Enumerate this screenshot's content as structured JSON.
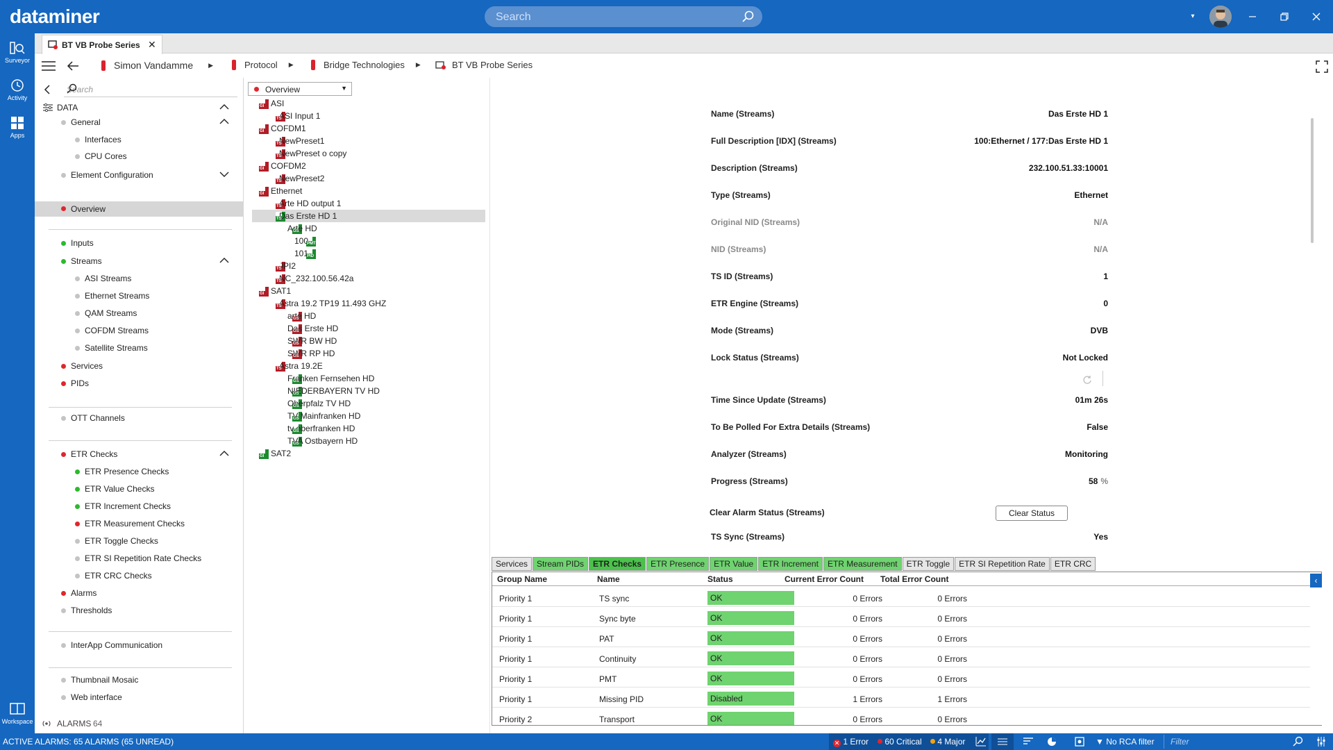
{
  "app": {
    "logo": "dataminer",
    "search_placeholder": "Search"
  },
  "rail": [
    {
      "label": "Surveyor",
      "icon": "surveyor-icon"
    },
    {
      "label": "Activity",
      "icon": "activity-icon"
    },
    {
      "label": "Apps",
      "icon": "apps-icon"
    },
    {
      "label": "Workspace",
      "icon": "workspace-icon"
    }
  ],
  "card_tab": {
    "title": "BT VB Probe Series",
    "close": "✕"
  },
  "breadcrumb": [
    "Simon Vandamme",
    "Protocol",
    "Bridge Technologies",
    "BT VB Probe Series"
  ],
  "nav": {
    "search_placeholder": "Search",
    "data_label": "DATA",
    "items": [
      {
        "label": "General",
        "dot": "gy",
        "indent": 0
      },
      {
        "label": "Interfaces",
        "dot": "gy",
        "indent": 1
      },
      {
        "label": "CPU Cores",
        "dot": "gy",
        "indent": 1
      },
      {
        "label": "Element Configuration",
        "dot": "gy",
        "indent": 0
      },
      {
        "label": "Overview",
        "dot": "r",
        "indent": 0
      },
      {
        "label": "Inputs",
        "dot": "g",
        "indent": 0
      },
      {
        "label": "Streams",
        "dot": "g",
        "indent": 0
      },
      {
        "label": "ASI Streams",
        "dot": "gy",
        "indent": 1
      },
      {
        "label": "Ethernet Streams",
        "dot": "gy",
        "indent": 1
      },
      {
        "label": "QAM Streams",
        "dot": "gy",
        "indent": 1
      },
      {
        "label": "COFDM Streams",
        "dot": "gy",
        "indent": 1
      },
      {
        "label": "Satellite Streams",
        "dot": "gy",
        "indent": 1
      },
      {
        "label": "Services",
        "dot": "r",
        "indent": 0
      },
      {
        "label": "PIDs",
        "dot": "r",
        "indent": 0
      },
      {
        "label": "OTT Channels",
        "dot": "gy",
        "indent": 0
      },
      {
        "label": "ETR Checks",
        "dot": "r",
        "indent": 0
      },
      {
        "label": "ETR Presence Checks",
        "dot": "g",
        "indent": 1
      },
      {
        "label": "ETR Value Checks",
        "dot": "g",
        "indent": 1
      },
      {
        "label": "ETR Increment Checks",
        "dot": "g",
        "indent": 1
      },
      {
        "label": "ETR Measurement Checks",
        "dot": "r",
        "indent": 1
      },
      {
        "label": "ETR Toggle Checks",
        "dot": "gy",
        "indent": 1
      },
      {
        "label": "ETR SI Repetition Rate Checks",
        "dot": "gy",
        "indent": 1
      },
      {
        "label": "ETR CRC Checks",
        "dot": "gy",
        "indent": 1
      },
      {
        "label": "Alarms",
        "dot": "r",
        "indent": 0
      },
      {
        "label": "Thresholds",
        "dot": "gy",
        "indent": 0
      },
      {
        "label": "InterApp Communication",
        "dot": "gy",
        "indent": 0
      },
      {
        "label": "Thumbnail Mosaic",
        "dot": "gy",
        "indent": 0
      },
      {
        "label": "Web interface",
        "dot": "gy",
        "indent": 0
      }
    ],
    "alarms_label": "ALARMS",
    "alarms_count": "64"
  },
  "tree": {
    "dropdown": "Overview",
    "nodes": [
      {
        "label": "ASI",
        "tag": "GI",
        "color": "red",
        "level": 0
      },
      {
        "label": "ASI Input 1",
        "tag": "TS",
        "color": "red",
        "level": 1
      },
      {
        "label": "COFDM1",
        "tag": "GI",
        "color": "red",
        "level": 0
      },
      {
        "label": "NewPreset1",
        "tag": "TS",
        "color": "red",
        "level": 1
      },
      {
        "label": "NewPreset o copy",
        "tag": "TS",
        "color": "red",
        "level": 1
      },
      {
        "label": "COFDM2",
        "tag": "GI",
        "color": "red",
        "level": 0
      },
      {
        "label": "NewPreset2",
        "tag": "TS",
        "color": "red",
        "level": 1
      },
      {
        "label": "Ethernet",
        "tag": "GI",
        "color": "red",
        "level": 0
      },
      {
        "label": "Arte HD output 1",
        "tag": "TS",
        "color": "red",
        "level": 1
      },
      {
        "label": "Das Erste HD 1",
        "tag": "TS",
        "color": "green",
        "level": 1,
        "selected": true
      },
      {
        "label": "Arte HD",
        "tag": "GS",
        "color": "green",
        "level": 2
      },
      {
        "label": "100",
        "tag": "PMT",
        "color": "green",
        "level": 3
      },
      {
        "label": "101",
        "tag": "PID",
        "color": "green",
        "level": 3
      },
      {
        "label": "JPI2",
        "tag": "TS",
        "color": "red",
        "level": 1
      },
      {
        "label": "NC_232.100.56.42a",
        "tag": "TS",
        "color": "red",
        "level": 1
      },
      {
        "label": "SAT1",
        "tag": "GI",
        "color": "red",
        "level": 0
      },
      {
        "label": "Astra 19.2 TP19 11.493 GHZ",
        "tag": "TS",
        "color": "red",
        "level": 1
      },
      {
        "label": "arte HD",
        "tag": "GS",
        "color": "red",
        "level": 2
      },
      {
        "label": "Das Erste HD",
        "tag": "GS",
        "color": "red",
        "level": 2
      },
      {
        "label": "SWR BW HD",
        "tag": "GS",
        "color": "red",
        "level": 2
      },
      {
        "label": "SWR RP HD",
        "tag": "GS",
        "color": "red",
        "level": 2
      },
      {
        "label": "Astra 19.2E",
        "tag": "TS",
        "color": "red",
        "level": 1
      },
      {
        "label": "Franken Fernsehen HD",
        "tag": "GS",
        "color": "green",
        "level": 2
      },
      {
        "label": "NIEDERBAYERN TV HD",
        "tag": "GS",
        "color": "green",
        "level": 2
      },
      {
        "label": "Oberpfalz TV HD",
        "tag": "GS",
        "color": "green",
        "level": 2
      },
      {
        "label": "TV Mainfranken HD",
        "tag": "GS",
        "color": "green",
        "level": 2
      },
      {
        "label": "tv oberfranken HD",
        "tag": "GS",
        "color": "green",
        "level": 2
      },
      {
        "label": "TVA Ostbayern HD",
        "tag": "GS",
        "color": "green",
        "level": 2
      },
      {
        "label": "SAT2",
        "tag": "GI",
        "color": "green",
        "level": 0
      }
    ]
  },
  "params": [
    {
      "name": "Name (Streams)",
      "value": "Das Erste HD 1"
    },
    {
      "name": "Full Description [IDX] (Streams)",
      "value": "100:Ethernet / 177:Das Erste HD 1"
    },
    {
      "name": "Description (Streams)",
      "value": "232.100.51.33:10001"
    },
    {
      "name": "Type (Streams)",
      "value": "Ethernet"
    },
    {
      "name": "Original NID (Streams)",
      "value": "N/A",
      "disabled": true
    },
    {
      "name": "NID (Streams)",
      "value": "N/A",
      "disabled": true
    },
    {
      "name": "TS ID (Streams)",
      "value": "1"
    },
    {
      "name": "ETR Engine (Streams)",
      "value": "0"
    },
    {
      "name": "Mode (Streams)",
      "value": "DVB"
    },
    {
      "name": "Lock Status (Streams)",
      "value": "Not Locked"
    },
    {
      "name": "Time Since Update (Streams)",
      "value": "01m 26s"
    },
    {
      "name": "To Be Polled For Extra Details (Streams)",
      "value": "False"
    },
    {
      "name": "Analyzer (Streams)",
      "value": "Monitoring"
    },
    {
      "name": "Progress (Streams)",
      "value": "58",
      "unit": "%"
    },
    {
      "name": "Clear Alarm Status (Streams)",
      "value": ""
    },
    {
      "name": "TS Sync (Streams)",
      "value": "Yes"
    }
  ],
  "clear_button": "Clear Status",
  "bottom_tabs": [
    {
      "label": "Services",
      "style": "gr"
    },
    {
      "label": "Stream PIDs",
      "style": "g"
    },
    {
      "label": "ETR Checks",
      "style": "sel"
    },
    {
      "label": "ETR Presence",
      "style": "g"
    },
    {
      "label": "ETR Value",
      "style": "g"
    },
    {
      "label": "ETR Increment",
      "style": "g"
    },
    {
      "label": "ETR Measurement",
      "style": "g"
    },
    {
      "label": "ETR Toggle",
      "style": "gr"
    },
    {
      "label": "ETR SI Repetition Rate",
      "style": "gr"
    },
    {
      "label": "ETR CRC",
      "style": "gr"
    }
  ],
  "grid": {
    "columns": [
      "Group Name",
      "Name",
      "Status",
      "Current Error Count",
      "Total Error Count"
    ],
    "rows": [
      [
        "Priority 1",
        "TS sync",
        "OK",
        "0 Errors",
        "0 Errors"
      ],
      [
        "Priority 1",
        "Sync byte",
        "OK",
        "0 Errors",
        "0 Errors"
      ],
      [
        "Priority 1",
        "PAT",
        "OK",
        "0 Errors",
        "0 Errors"
      ],
      [
        "Priority 1",
        "Continuity",
        "OK",
        "0 Errors",
        "0 Errors"
      ],
      [
        "Priority 1",
        "PMT",
        "OK",
        "0 Errors",
        "0 Errors"
      ],
      [
        "Priority 1",
        "Missing PID",
        "Disabled",
        "1 Errors",
        "1 Errors"
      ],
      [
        "Priority 2",
        "Transport",
        "OK",
        "0 Errors",
        "0 Errors"
      ]
    ]
  },
  "statusbar": {
    "active_alarms": "ACTIVE ALARMS: 65 ALARMS (65 UNREAD)",
    "errors": "1 Error",
    "critical": "60 Critical",
    "major": "4 Major",
    "rca": "No RCA filter",
    "filter_placeholder": "Filter"
  },
  "colors": {
    "brand": "#1567c0",
    "ok": "#6fd36f",
    "alarm": "#e0262d",
    "element": "#b11d27"
  }
}
